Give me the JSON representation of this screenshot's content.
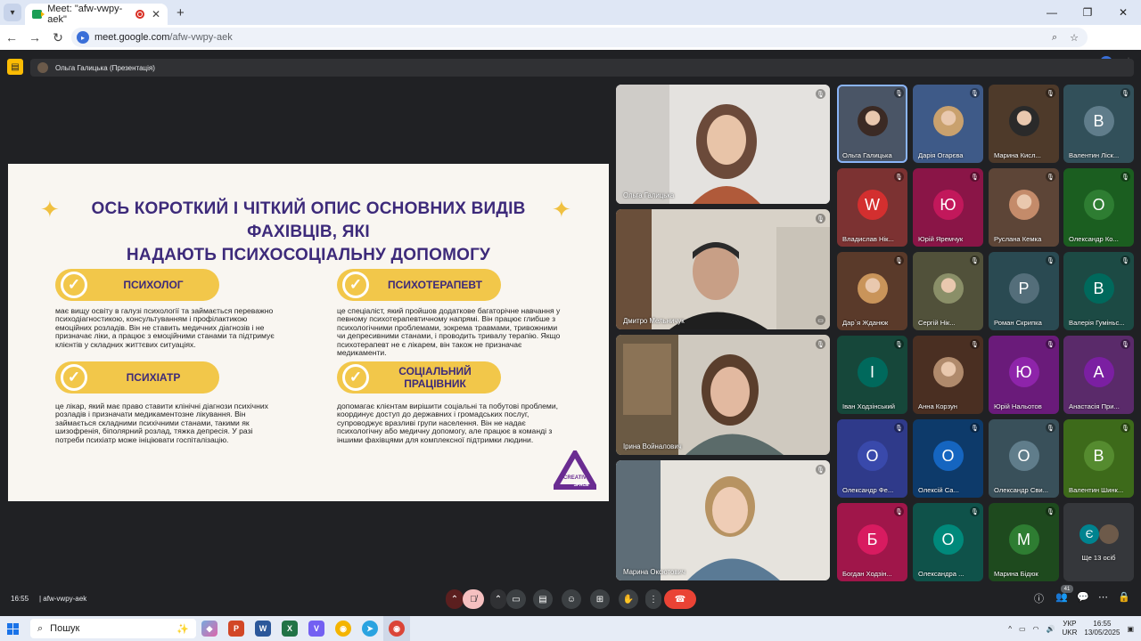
{
  "browser": {
    "tab_title": "Meet: \"afw-vwpy-aek\"",
    "url_host": "meet.google.com",
    "url_path": "/afw-vwpy-aek",
    "profile_initial": "Д"
  },
  "presenter_bar": {
    "label": "Ольга Галицька (Презентація)"
  },
  "slide": {
    "title_line1": "Ось короткий і чіткий опис основних видів фахівців, які",
    "title_line2": "надають психосоціальну допомогу",
    "cards": [
      {
        "heading": "Психолог",
        "text": "має вищу освіту в галузі психології та займається переважно психодіагностикою, консультуванням і профілактикою емоційних розладів. Він не ставить медичних діагнозів і не призначає ліки, а працює з емоційними станами та підтримує клієнтів у складних життєвих ситуаціях."
      },
      {
        "heading": "Психотерапевт",
        "text": "це спеціаліст, який пройшов додаткове багаторічне навчання у певному психотерапевтичному напрямі. Він працює глибше з психологічними проблемами, зокрема травмами, тривожними чи депресивними станами, і проводить тривалу терапію. Якщо психотерапевт не є лікарем, він також не призначає медикаменти."
      },
      {
        "heading": "Психіатр",
        "text": "це лікар, який має право ставити клінічні діагнози психічних розладів і призначати медикаментозне лікування. Він займається складними психічними станами, такими як шизофренія, біполярний розлад, тяжка депресія. У разі потреби психіатр може ініціювати госпіталізацію."
      },
      {
        "heading": "Соціальний працівник",
        "text": "допомагає клієнтам вирішити соціальні та побутові проблеми, координує доступ до державних і громадських послуг, супроводжує вразливі групи населення. Він не надає психологічну або медичну допомогу, але працює в команді з іншими фахівцями для комплексної підтримки людини."
      }
    ],
    "logo_text_top": "CREATIV",
    "logo_text_bottom": "SPACE"
  },
  "video_tiles": [
    {
      "name": "Ольга Галицька",
      "bg": "#d9d6d2"
    },
    {
      "name": "Дмитро Мельничук",
      "bg": "#8a7f74"
    },
    {
      "name": "Ірина Войналович",
      "bg": "#7b7466"
    },
    {
      "name": "Марина Оксютович",
      "bg": "#b9b3a8"
    }
  ],
  "participants": [
    {
      "name": "Ольга Галицька",
      "bg": "#4a5566",
      "letter": "",
      "photo": true,
      "photo_color": "#3b2a24",
      "highlight": true
    },
    {
      "name": "Дарія Огарєва",
      "bg": "#3e5a88",
      "letter": "",
      "photo": true,
      "photo_color": "#c9a16e"
    },
    {
      "name": "Марина Кисл...",
      "bg": "#4e3a2a",
      "letter": "",
      "photo": true,
      "photo_color": "#2a2a2a"
    },
    {
      "name": "Валентин Ліск...",
      "bg": "#32505a",
      "letter": "В",
      "circle": "#607d8b"
    },
    {
      "name": "Владислав Нік...",
      "bg": "#7c3232",
      "letter": "W",
      "circle": "#d32f2f"
    },
    {
      "name": "Юрій Яремчук",
      "bg": "#8a1547",
      "letter": "Ю",
      "circle": "#c2185b"
    },
    {
      "name": "Руслана Кемка",
      "bg": "#5d4537",
      "letter": "",
      "photo": true,
      "photo_color": "#c48b6a"
    },
    {
      "name": "Олександр Ко...",
      "bg": "#1b5e20",
      "letter": "О",
      "circle": "#2e7d32"
    },
    {
      "name": "Дар`я Жданюк",
      "bg": "#5a3a2a",
      "letter": "",
      "photo": true,
      "photo_color": "#c9945a"
    },
    {
      "name": "Сергій Нік...",
      "bg": "#51513a",
      "letter": "",
      "photo": true,
      "photo_color": "#8a8f68"
    },
    {
      "name": "Роман Скрипка",
      "bg": "#2a4a52",
      "letter": "Р",
      "circle": "#546e7a"
    },
    {
      "name": "Валерія Гуміньс...",
      "bg": "#1c4a44",
      "letter": "В",
      "circle": "#00695c"
    },
    {
      "name": "Іван Ходзінський",
      "bg": "#16473a",
      "letter": "І",
      "circle": "#00695c"
    },
    {
      "name": "Анна Корзун",
      "bg": "#4a2f22",
      "letter": "",
      "photo": true,
      "photo_color": "#b08a6c"
    },
    {
      "name": "Юрій Нальотов",
      "bg": "#6a1b7a",
      "letter": "Ю",
      "circle": "#8e24aa"
    },
    {
      "name": "Анастасія При...",
      "bg": "#5a2a6a",
      "letter": "А",
      "circle": "#7b1fa2"
    },
    {
      "name": "Олександр Фе...",
      "bg": "#2f3a8a",
      "letter": "О",
      "circle": "#3949ab"
    },
    {
      "name": "Олексій Са...",
      "bg": "#0d3a6a",
      "letter": "О",
      "circle": "#1565c0"
    },
    {
      "name": "Олександр Сви...",
      "bg": "#39505a",
      "letter": "О",
      "circle": "#607d8b"
    },
    {
      "name": "Валентин Шинк...",
      "bg": "#3d6a1a",
      "letter": "В",
      "circle": "#558b2f"
    },
    {
      "name": "Богдан Ходзін...",
      "bg": "#a0164a",
      "letter": "Б",
      "circle": "#d81b60"
    },
    {
      "name": "Олександра ...",
      "bg": "#0f524a",
      "letter": "О",
      "circle": "#00897b"
    },
    {
      "name": "Марина Бідюк",
      "bg": "#1e4a1e",
      "letter": "М",
      "circle": "#2e7d32"
    },
    {
      "name": "Ще 13 осіб",
      "bg": "#35373b",
      "letter": "",
      "more": true
    }
  ],
  "bottom_bar": {
    "time": "16:55",
    "meeting_code": "afw-vwpy-aek",
    "people_count": "41"
  },
  "taskbar": {
    "search_label": "Пошук",
    "lang_top": "УКР",
    "lang_bottom": "UKR",
    "clock_time": "16:55",
    "clock_date": "13/05/2025"
  }
}
